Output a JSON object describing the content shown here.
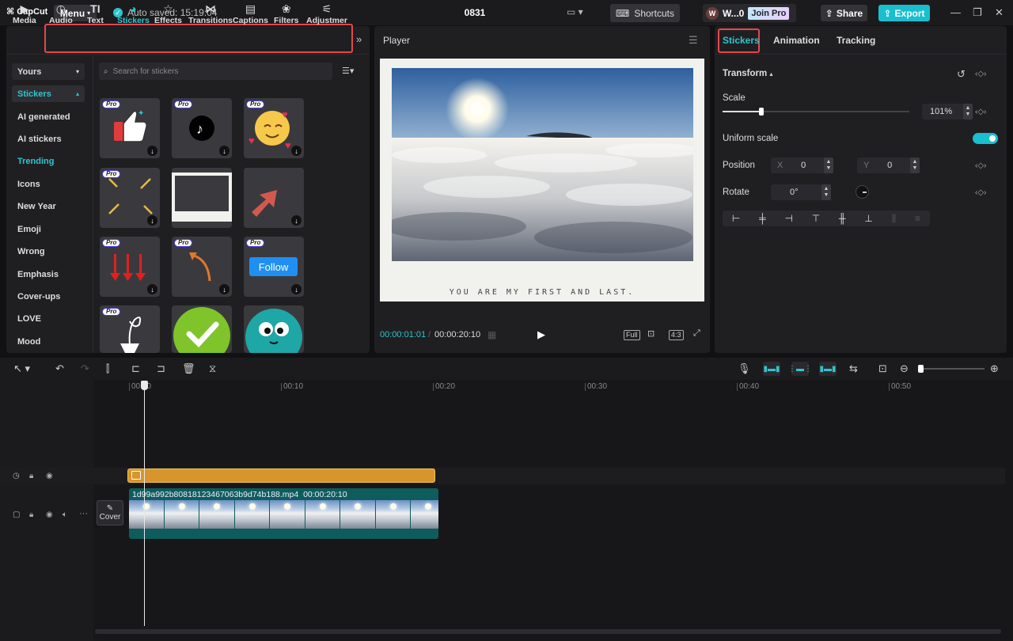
{
  "app": {
    "logo": "CapCut",
    "menu_label": "Menu",
    "autosave": "Auto saved: 15:19:04",
    "project_title": "0831",
    "shortcuts_label": "Shortcuts",
    "user_initial": "W",
    "user_name": "W...0",
    "join_pro": "Join Pro",
    "share_label": "Share",
    "export_label": "Export",
    "accent_color": "#19bfcf"
  },
  "toolbar": {
    "items": [
      {
        "label": "Media",
        "icon": "media-icon"
      },
      {
        "label": "Audio",
        "icon": "audio-icon"
      },
      {
        "label": "Text",
        "icon": "text-icon"
      },
      {
        "label": "Stickers",
        "icon": "stickers-icon",
        "active": true
      },
      {
        "label": "Effects",
        "icon": "effects-icon"
      },
      {
        "label": "Transitions",
        "icon": "transitions-icon"
      },
      {
        "label": "Captions",
        "icon": "captions-icon"
      },
      {
        "label": "Filters",
        "icon": "filters-icon"
      },
      {
        "label": "Adjustmer",
        "icon": "adjustment-icon"
      }
    ]
  },
  "library": {
    "yours": "Yours",
    "stickers": "Stickers",
    "categories": [
      "AI generated",
      "AI stickers",
      "Trending",
      "Icons",
      "New Year",
      "Emoji",
      "Wrong",
      "Emphasis",
      "Cover-ups",
      "LOVE",
      "Mood"
    ],
    "active_category": "Trending",
    "search_placeholder": "Search for stickers",
    "pro_badge": "Pro",
    "follow_text": "Follow"
  },
  "player": {
    "title": "Player",
    "caption": "YOU ARE MY FIRST AND LAST.",
    "current_time": "00:00:01:01",
    "total_time": "00:00:20:10",
    "full_label": "Full",
    "ratio_label": "4:3"
  },
  "inspector": {
    "tabs": [
      "Stickers",
      "Animation",
      "Tracking"
    ],
    "transform": "Transform",
    "scale_label": "Scale",
    "scale_value": "101%",
    "scale_fraction": 0.25,
    "uniform_scale": "Uniform scale",
    "position_label": "Position",
    "x_label": "X",
    "x_value": "0",
    "y_label": "Y",
    "y_value": "0",
    "rotate_label": "Rotate",
    "rotate_value": "0°"
  },
  "timeline": {
    "ruler": [
      "00:00",
      "00:10",
      "00:20",
      "00:30",
      "00:40",
      "00:50"
    ],
    "cover_label": "Cover",
    "clip_name": "1d99a992b80818123467063b9d74b188.mp4",
    "clip_duration": "00:00:20:10"
  }
}
